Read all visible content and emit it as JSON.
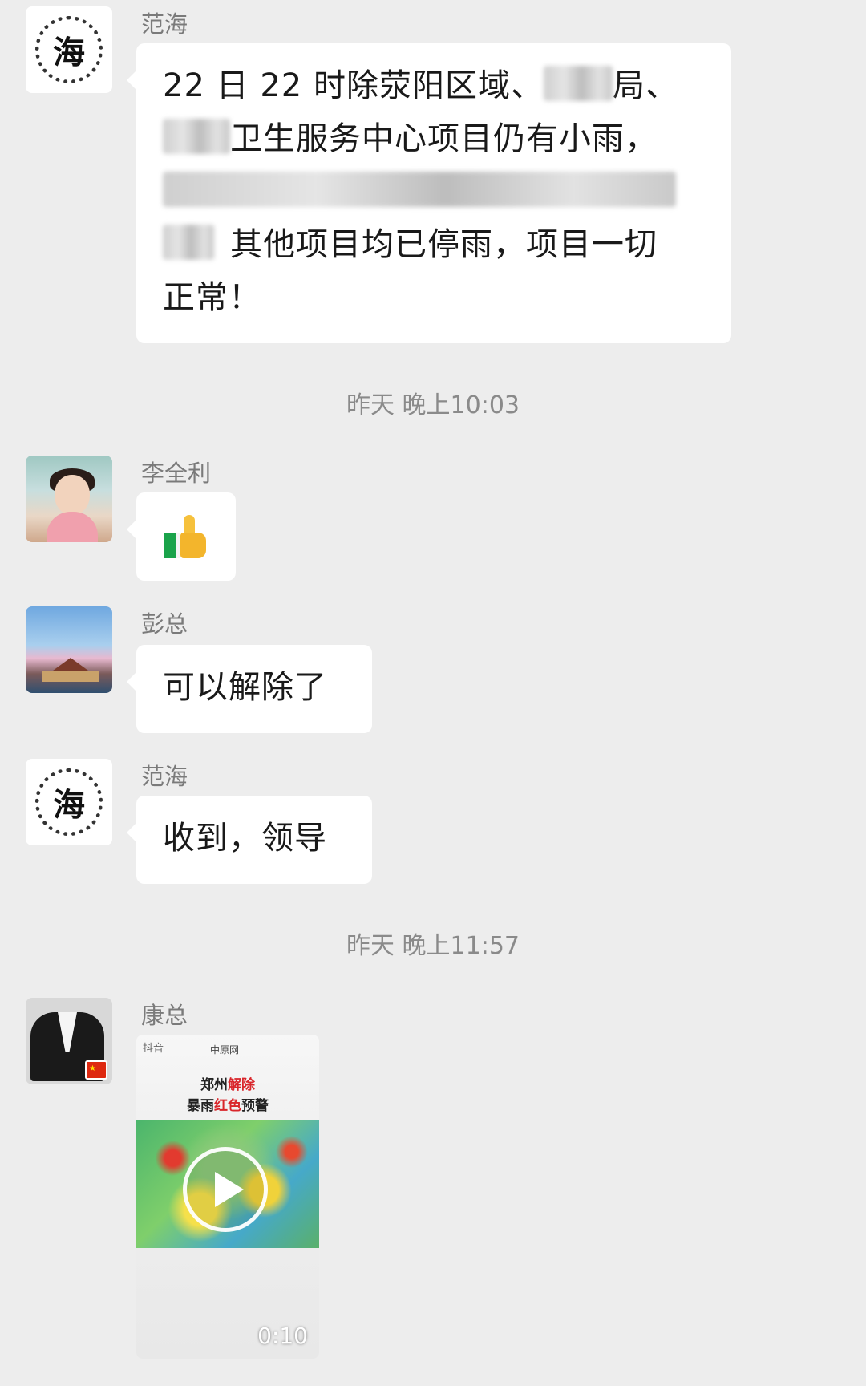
{
  "messages": [
    {
      "sender": "范海",
      "text_line1": "22 日 22 时除荥阳区域、",
      "text_line1b": "局、",
      "text_line2": "卫生服务中心项目仍有小雨，",
      "text_line4": "其他项目均已停雨，项目一切",
      "text_line5": "正常！"
    },
    {
      "sender": "李全利",
      "emoji": "thumbs-up"
    },
    {
      "sender": "彭总",
      "text": "可以解除了"
    },
    {
      "sender": "范海",
      "text": "收到，领导"
    },
    {
      "sender": "康总",
      "video": {
        "app_label": "抖音",
        "brand_label": "中原网",
        "title_line1_a": "郑州",
        "title_line1_b": "解除",
        "title_line2_a": "暴雨",
        "title_line2_b": "红色",
        "title_line2_c": "预警",
        "duration": "0:10"
      }
    }
  ],
  "timestamps": [
    "昨天 晚上10:03",
    "昨天 晚上11:57"
  ],
  "avatars": {
    "fanhai_char": "海"
  }
}
